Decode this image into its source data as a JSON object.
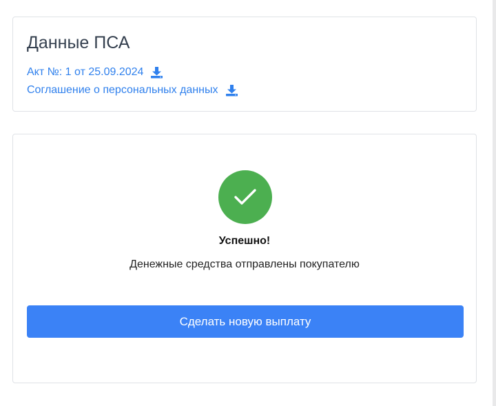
{
  "psa_card": {
    "title": "Данные ПСА",
    "act_link": "Акт №: 1 от 25.09.2024",
    "consent_link": "Соглашение о персональных данных"
  },
  "result_card": {
    "status": "Успешно!",
    "message": "Денежные средства отправлены покупателю",
    "new_payout_button": "Сделать новую выплату"
  },
  "icons": {
    "download": "download-icon",
    "success": "check-icon"
  },
  "colors": {
    "link": "#2f80ed",
    "success": "#4caf50",
    "primary_button": "#3b82f6",
    "title": "#35404f",
    "border": "#dfe2e6"
  }
}
